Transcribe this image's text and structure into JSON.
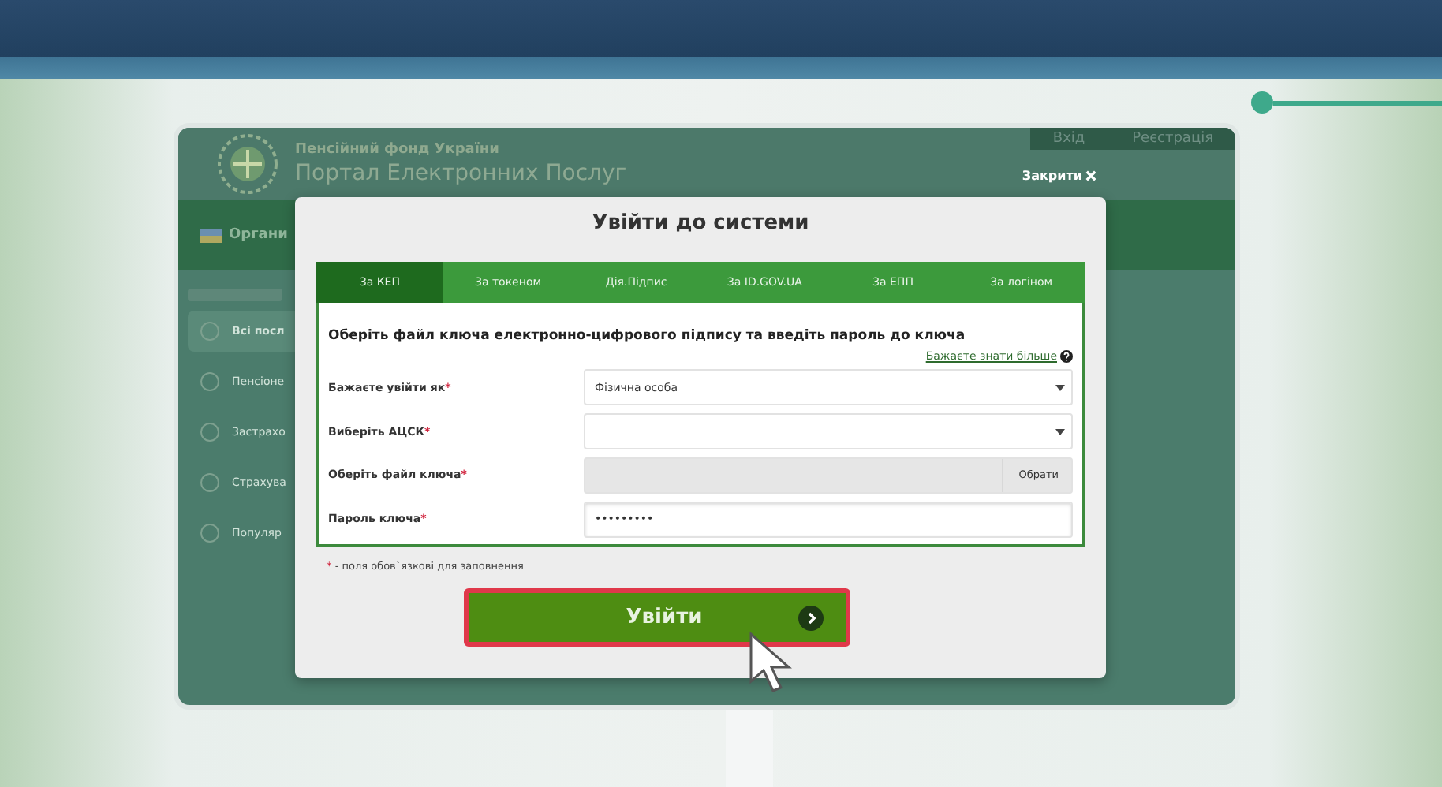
{
  "portal": {
    "org": "Пенсійний фонд України",
    "title": "Портал Електронних Послуг",
    "header_links": [
      {
        "label": "Вхід"
      },
      {
        "label": "Реєстрація"
      }
    ],
    "close": "Закрити",
    "nav": "Органи",
    "sidebar": [
      {
        "label": "Всі посл",
        "selected": true
      },
      {
        "label": "Пенсіоне",
        "selected": false
      },
      {
        "label": "Застрахо",
        "selected": false
      },
      {
        "label": "Страхува",
        "selected": false
      },
      {
        "label": "Популяр",
        "selected": false
      }
    ]
  },
  "modal": {
    "title": "Увійти до системи",
    "tabs": [
      {
        "label": "За КЕП",
        "selected": true
      },
      {
        "label": "За токеном",
        "selected": false
      },
      {
        "label": "Дія.Підпис",
        "selected": false
      },
      {
        "label": "За ID.GOV.UA",
        "selected": false
      },
      {
        "label": "За ЕПП",
        "selected": false
      },
      {
        "label": "За логіном",
        "selected": false
      }
    ],
    "heading": "Оберіть файл ключа електронно-цифрового підпису та введіть пароль до ключа",
    "more_link": "Бажаєте знати більше",
    "fields": [
      {
        "kind": "select",
        "label": "Бажаєте увійти як",
        "mark": "*",
        "value": "Фізична особа"
      },
      {
        "kind": "select",
        "label": "Виберіть АЦСК",
        "mark": "*"
      },
      {
        "kind": "file",
        "label": "Оберіть файл ключа",
        "mark": "*",
        "button": "Обрати"
      },
      {
        "kind": "password",
        "label": "Пароль ключа",
        "mark": "*",
        "value": "•••••••••"
      }
    ],
    "note": {
      "mark": "*",
      "text": " - поля обов`язкові для заповнення"
    },
    "submit": "Увійти"
  }
}
